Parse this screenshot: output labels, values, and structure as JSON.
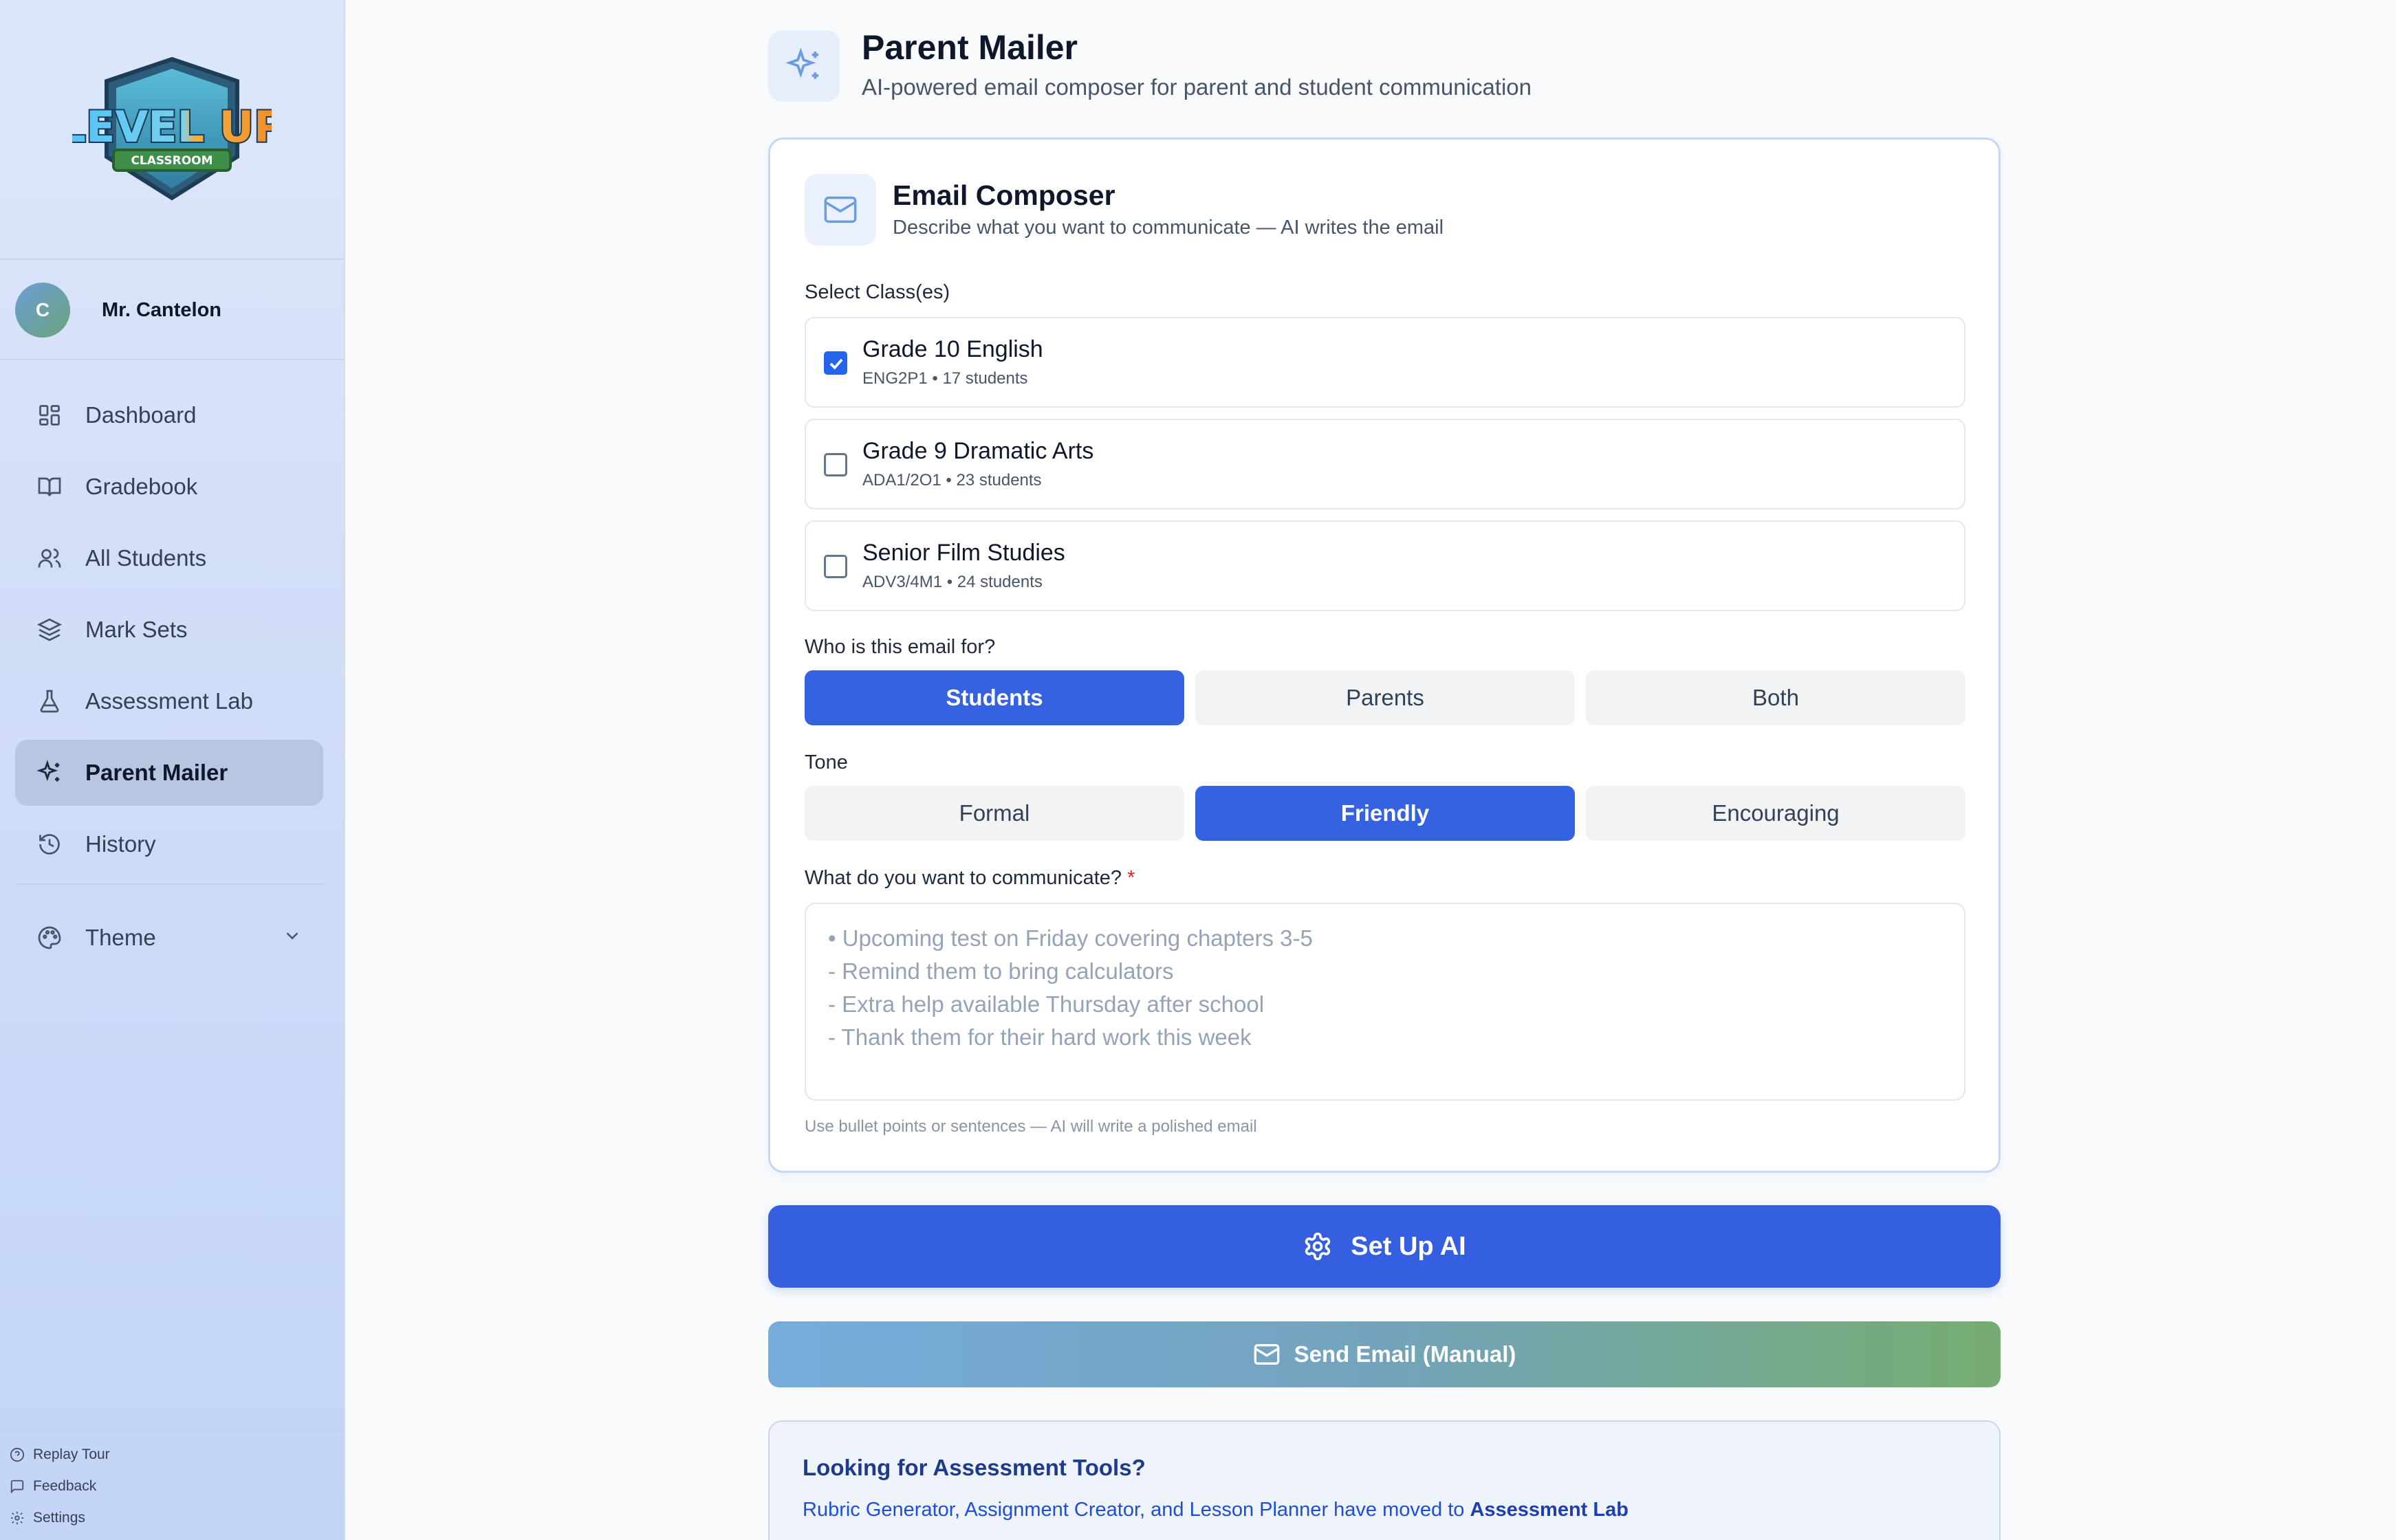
{
  "app": {
    "logo_text": "LEVEL UP",
    "logo_sub": "CLASSROOM"
  },
  "user": {
    "initial": "C",
    "name": "Mr. Cantelon"
  },
  "sidebar": {
    "items": [
      {
        "label": "Dashboard",
        "icon": "dashboard-icon",
        "active": false
      },
      {
        "label": "Gradebook",
        "icon": "book-icon",
        "active": false
      },
      {
        "label": "All Students",
        "icon": "users-icon",
        "active": false
      },
      {
        "label": "Mark Sets",
        "icon": "layers-icon",
        "active": false
      },
      {
        "label": "Assessment Lab",
        "icon": "flask-icon",
        "active": false
      },
      {
        "label": "Parent Mailer",
        "icon": "sparkles-icon",
        "active": true
      },
      {
        "label": "History",
        "icon": "history-icon",
        "active": false
      }
    ],
    "theme_label": "Theme",
    "footer": {
      "replay_tour": "Replay Tour",
      "feedback": "Feedback",
      "settings": "Settings"
    }
  },
  "header": {
    "title": "Parent Mailer",
    "subtitle": "AI-powered email composer for parent and student communication"
  },
  "composer": {
    "title": "Email Composer",
    "subtitle": "Describe what you want to communicate — AI writes the email",
    "select_label": "Select Class(es)",
    "classes": [
      {
        "name": "Grade 10 English",
        "meta": "ENG2P1 • 17 students",
        "checked": true
      },
      {
        "name": "Grade 9 Dramatic Arts",
        "meta": "ADA1/2O1 • 23 students",
        "checked": false
      },
      {
        "name": "Senior Film Studies",
        "meta": "ADV3/4M1 • 24 students",
        "checked": false
      }
    ],
    "audience_label": "Who is this email for?",
    "audience": [
      {
        "label": "Students",
        "active": true
      },
      {
        "label": "Parents",
        "active": false
      },
      {
        "label": "Both",
        "active": false
      }
    ],
    "tone_label": "Tone",
    "tone": [
      {
        "label": "Formal",
        "active": false
      },
      {
        "label": "Friendly",
        "active": true
      },
      {
        "label": "Encouraging",
        "active": false
      }
    ],
    "message_label": "What do you want to communicate?",
    "required_mark": "*",
    "message_placeholder": "• Upcoming test on Friday covering chapters 3-5\n- Remind them to bring calculators\n- Extra help available Thursday after school\n- Thank them for their hard work this week",
    "message_value": "",
    "hint": "Use bullet points or sentences — AI will write a polished email"
  },
  "actions": {
    "setup_ai": "Set Up AI",
    "send_manual": "Send Email (Manual)"
  },
  "info": {
    "title": "Looking for Assessment Tools?",
    "text": "Rubric Generator, Assignment Creator, and Lesson Planner have moved to",
    "link": "Assessment Lab"
  },
  "colors": {
    "primary": "#345fe0",
    "active_nav": "#b7c7e1",
    "required": "#dc2626"
  }
}
